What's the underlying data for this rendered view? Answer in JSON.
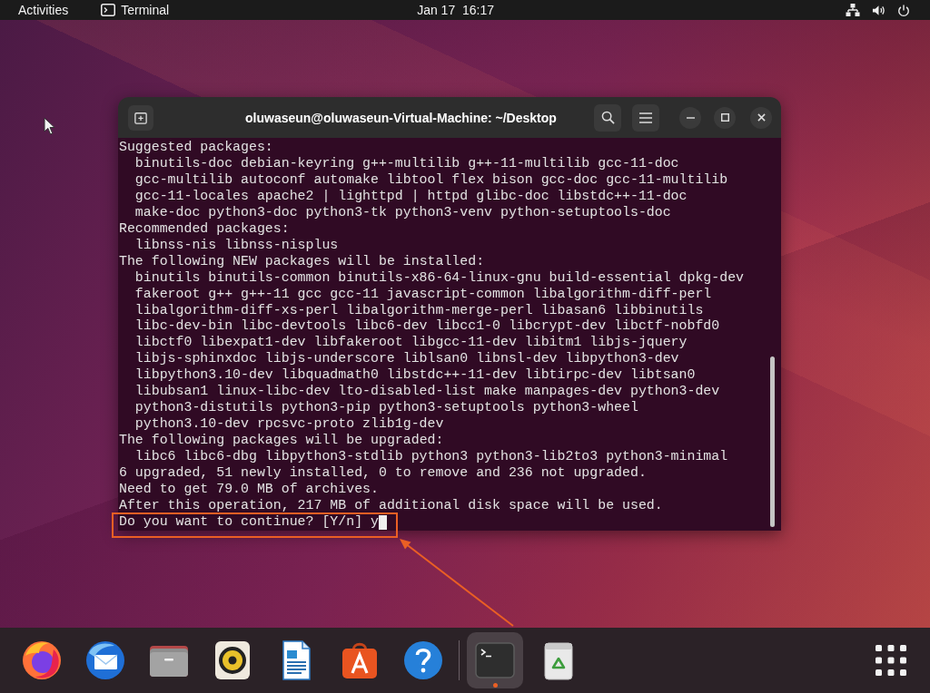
{
  "top_bar": {
    "activities": "Activities",
    "app_name": "Terminal",
    "clock": "Jan 17  16:17"
  },
  "terminal": {
    "title": "oluwaseun@oluwaseun-Virtual-Machine: ~/Desktop",
    "output": [
      {
        "text": "Suggested packages:",
        "children": [
          "binutils-doc debian-keyring g++-multilib g++-11-multilib gcc-11-doc",
          "gcc-multilib autoconf automake libtool flex bison gcc-doc gcc-11-multilib",
          "gcc-11-locales apache2 | lighttpd | httpd glibc-doc libstdc++-11-doc",
          "make-doc python3-doc python3-tk python3-venv python-setuptools-doc"
        ]
      },
      {
        "text": "Recommended packages:",
        "children": [
          "libnss-nis libnss-nisplus"
        ]
      },
      {
        "text": "The following NEW packages will be installed:",
        "children": [
          "binutils binutils-common binutils-x86-64-linux-gnu build-essential dpkg-dev",
          "fakeroot g++ g++-11 gcc gcc-11 javascript-common libalgorithm-diff-perl",
          "libalgorithm-diff-xs-perl libalgorithm-merge-perl libasan6 libbinutils",
          "libc-dev-bin libc-devtools libc6-dev libcc1-0 libcrypt-dev libctf-nobfd0",
          "libctf0 libexpat1-dev libfakeroot libgcc-11-dev libitm1 libjs-jquery",
          "libjs-sphinxdoc libjs-underscore liblsan0 libnsl-dev libpython3-dev",
          "libpython3.10-dev libquadmath0 libstdc++-11-dev libtirpc-dev libtsan0",
          "libubsan1 linux-libc-dev lto-disabled-list make manpages-dev python3-dev",
          "python3-distutils python3-pip python3-setuptools python3-wheel",
          "python3.10-dev rpcsvc-proto zlib1g-dev"
        ]
      },
      {
        "text": "The following packages will be upgraded:",
        "children": [
          "libc6 libc6-dbg libpython3-stdlib python3 python3-lib2to3 python3-minimal"
        ]
      },
      {
        "text": "6 upgraded, 51 newly installed, 0 to remove and 236 not upgraded."
      },
      {
        "text": "Need to get 79.0 MB of archives."
      },
      {
        "text": "After this operation, 217 MB of additional disk space will be used."
      }
    ],
    "prompt": "Do you want to continue? [Y/n] y",
    "prompt_highlighted": true
  },
  "dock": {
    "items": [
      {
        "kind": "browser",
        "active": false
      },
      {
        "kind": "mail",
        "active": false
      },
      {
        "kind": "files",
        "active": false
      },
      {
        "kind": "music",
        "active": false
      },
      {
        "kind": "writer",
        "active": false
      },
      {
        "kind": "store",
        "active": false
      },
      {
        "kind": "help",
        "active": false
      },
      {
        "kind": "terminal",
        "active": true
      },
      {
        "kind": "trash",
        "active": false
      }
    ]
  }
}
